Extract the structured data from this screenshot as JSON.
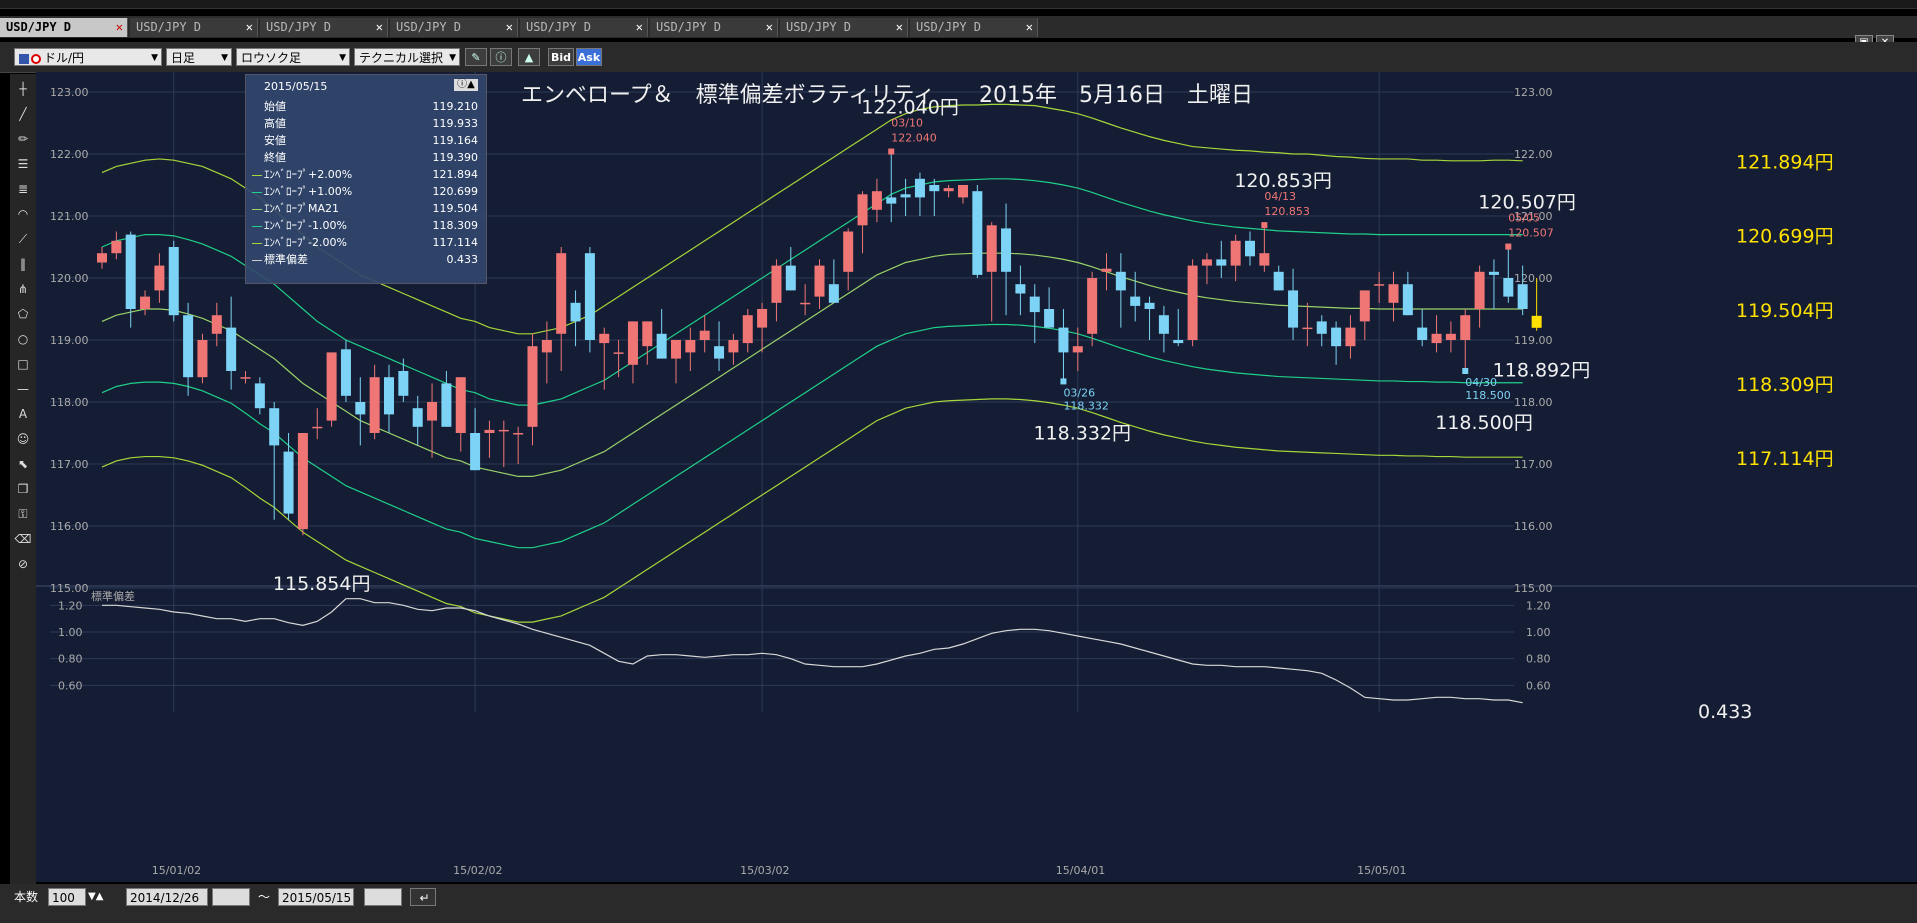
{
  "tabs": [
    {
      "label": "USD/JPY D",
      "active": true
    },
    {
      "label": "USD/JPY D",
      "active": false
    },
    {
      "label": "USD/JPY D",
      "active": false
    },
    {
      "label": "USD/JPY D",
      "active": false
    },
    {
      "label": "USD/JPY D",
      "active": false
    },
    {
      "label": "USD/JPY D",
      "active": false
    },
    {
      "label": "USD/JPY D",
      "active": false
    },
    {
      "label": "USD/JPY D",
      "active": false
    }
  ],
  "toolbar": {
    "currency": "ドル/円",
    "period": "日足",
    "chart_style": "ロウソク足",
    "technical": "テクニカル選択",
    "bid": "Bid",
    "ask": "Ask"
  },
  "info": {
    "date": "2015/05/15",
    "rows": [
      {
        "label": "始値",
        "value": "119.210"
      },
      {
        "label": "高値",
        "value": "119.933"
      },
      {
        "label": "安値",
        "value": "119.164"
      },
      {
        "label": "終値",
        "value": "119.390"
      },
      {
        "label": "ｴﾝﾍﾞﾛｰﾌﾟ+2.00%",
        "value": "121.894",
        "color": "#a6d63a"
      },
      {
        "label": "ｴﾝﾍﾞﾛｰﾌﾟ+1.00%",
        "value": "120.699",
        "color": "#1fd08a"
      },
      {
        "label": "ｴﾝﾍﾞﾛｰﾌﾟMA21",
        "value": "119.504",
        "color": "#9bd36a"
      },
      {
        "label": "ｴﾝﾍﾞﾛｰﾌﾟ-1.00%",
        "value": "118.309",
        "color": "#1fd08a"
      },
      {
        "label": "ｴﾝﾍﾞﾛｰﾌﾟ-2.00%",
        "value": "117.114",
        "color": "#a6d63a"
      },
      {
        "label": "標準偏差",
        "value": "0.433",
        "color": "#cccccc"
      }
    ]
  },
  "bottom": {
    "count_label": "本数",
    "count": "100",
    "from": "2014/12/26",
    "tilde": "～",
    "to": "2015/05/15"
  },
  "chart_data": {
    "type": "candlestick",
    "title": "エンベロープ＆　標準偏差ボラティリティ　　2015年　5月16日　土曜日",
    "ylim": [
      115.0,
      123.0
    ],
    "yticks": [
      "123.00",
      "122.00",
      "121.00",
      "120.00",
      "119.00",
      "118.00",
      "117.00",
      "116.00",
      "115.00"
    ],
    "xticks": [
      "15/01/02",
      "15/02/02",
      "15/03/02",
      "15/04/01",
      "15/05/01"
    ],
    "colors": {
      "up": "#f07676",
      "down": "#7dd3f5",
      "band2": "#a6d63a",
      "band1": "#1fd08a",
      "ma": "#9bd36a"
    },
    "candles": [
      [
        120.25,
        120.5,
        120.15,
        120.4
      ],
      [
        120.4,
        120.75,
        120.3,
        120.6
      ],
      [
        120.7,
        120.75,
        119.2,
        119.5
      ],
      [
        119.5,
        119.8,
        119.4,
        119.7
      ],
      [
        119.8,
        120.4,
        119.6,
        120.2
      ],
      [
        120.5,
        120.6,
        119.3,
        119.4
      ],
      [
        119.4,
        119.6,
        118.1,
        118.4
      ],
      [
        118.4,
        119.1,
        118.3,
        119.0
      ],
      [
        119.1,
        119.6,
        118.9,
        119.4
      ],
      [
        119.2,
        119.7,
        118.2,
        118.5
      ],
      [
        118.4,
        118.5,
        118.3,
        118.4
      ],
      [
        118.3,
        118.4,
        117.8,
        117.9
      ],
      [
        117.9,
        118.0,
        116.1,
        117.3
      ],
      [
        117.2,
        117.5,
        116.1,
        116.2
      ],
      [
        115.95,
        117.5,
        115.85,
        117.5
      ],
      [
        117.6,
        117.9,
        117.4,
        117.6
      ],
      [
        117.7,
        118.8,
        117.6,
        118.8
      ],
      [
        118.85,
        119.0,
        118.0,
        118.1
      ],
      [
        118.0,
        118.4,
        117.3,
        117.8
      ],
      [
        117.5,
        118.6,
        117.4,
        118.4
      ],
      [
        118.4,
        118.6,
        117.5,
        117.8
      ],
      [
        118.5,
        118.7,
        118.0,
        118.1
      ],
      [
        117.9,
        118.1,
        117.3,
        117.6
      ],
      [
        117.7,
        118.3,
        117.1,
        118.0
      ],
      [
        118.3,
        118.5,
        117.6,
        117.6
      ],
      [
        117.5,
        118.2,
        117.2,
        118.4
      ],
      [
        117.5,
        117.9,
        117.0,
        116.9
      ],
      [
        117.5,
        117.7,
        117.1,
        117.55
      ],
      [
        117.55,
        117.7,
        116.95,
        117.55
      ],
      [
        117.5,
        117.6,
        117.0,
        117.5
      ],
      [
        117.6,
        119.1,
        117.3,
        118.9
      ],
      [
        118.8,
        119.3,
        118.3,
        119.0
      ],
      [
        119.1,
        120.5,
        118.5,
        120.4
      ],
      [
        119.6,
        119.8,
        118.9,
        119.3
      ],
      [
        120.4,
        120.5,
        118.8,
        119.0
      ],
      [
        118.95,
        119.2,
        118.2,
        119.1
      ],
      [
        118.8,
        119.0,
        118.4,
        118.8
      ],
      [
        118.6,
        119.3,
        118.3,
        119.3
      ],
      [
        118.9,
        119.3,
        118.6,
        119.3
      ],
      [
        119.1,
        119.5,
        118.8,
        118.7
      ],
      [
        118.7,
        119.0,
        118.3,
        119.0
      ],
      [
        118.8,
        119.2,
        118.5,
        119.0
      ],
      [
        119.0,
        119.4,
        118.8,
        119.15
      ],
      [
        118.9,
        119.3,
        118.5,
        118.7
      ],
      [
        118.8,
        119.1,
        118.6,
        119.0
      ],
      [
        118.95,
        119.5,
        118.8,
        119.4
      ],
      [
        119.2,
        119.6,
        118.8,
        119.5
      ],
      [
        119.6,
        120.3,
        119.3,
        120.2
      ],
      [
        120.2,
        120.5,
        119.8,
        119.8
      ],
      [
        119.6,
        119.9,
        119.4,
        119.6
      ],
      [
        119.7,
        120.3,
        119.5,
        120.2
      ],
      [
        119.9,
        120.3,
        119.6,
        119.6
      ],
      [
        120.1,
        120.8,
        119.8,
        120.75
      ],
      [
        120.85,
        121.4,
        120.4,
        121.35
      ],
      [
        121.1,
        121.6,
        120.9,
        121.4
      ],
      [
        121.3,
        122.04,
        120.9,
        121.2
      ],
      [
        121.35,
        121.6,
        121.0,
        121.3
      ],
      [
        121.6,
        121.7,
        121.0,
        121.3
      ],
      [
        121.5,
        121.6,
        121.0,
        121.4
      ],
      [
        121.4,
        121.5,
        121.3,
        121.45
      ],
      [
        121.3,
        121.5,
        121.2,
        121.5
      ],
      [
        121.4,
        121.5,
        120.0,
        120.05
      ],
      [
        120.1,
        120.9,
        119.3,
        120.85
      ],
      [
        120.8,
        121.2,
        119.4,
        120.1
      ],
      [
        119.9,
        120.2,
        119.4,
        119.75
      ],
      [
        119.7,
        119.9,
        118.95,
        119.45
      ],
      [
        119.5,
        119.85,
        119.2,
        119.2
      ],
      [
        119.2,
        119.5,
        118.33,
        118.8
      ],
      [
        118.8,
        119.2,
        118.5,
        118.9
      ],
      [
        119.1,
        120.1,
        118.9,
        120.0
      ],
      [
        120.1,
        120.4,
        119.8,
        120.15
      ],
      [
        120.1,
        120.4,
        119.2,
        119.8
      ],
      [
        119.7,
        120.1,
        119.3,
        119.55
      ],
      [
        119.6,
        119.7,
        119.0,
        119.5
      ],
      [
        119.4,
        119.55,
        118.8,
        119.1
      ],
      [
        119.0,
        119.5,
        118.9,
        118.95
      ],
      [
        119.0,
        120.3,
        118.9,
        120.2
      ],
      [
        120.2,
        120.4,
        119.9,
        120.3
      ],
      [
        120.3,
        120.6,
        120.0,
        120.2
      ],
      [
        120.2,
        120.7,
        119.95,
        120.6
      ],
      [
        120.6,
        120.75,
        120.2,
        120.35
      ],
      [
        120.2,
        120.85,
        120.1,
        120.4
      ],
      [
        120.1,
        120.2,
        119.8,
        119.8
      ],
      [
        119.8,
        120.15,
        119.0,
        119.2
      ],
      [
        119.2,
        119.6,
        118.9,
        119.2
      ],
      [
        119.3,
        119.4,
        118.9,
        119.1
      ],
      [
        119.2,
        119.3,
        118.6,
        118.9
      ],
      [
        118.9,
        119.4,
        118.7,
        119.2
      ],
      [
        119.3,
        119.8,
        119.0,
        119.8
      ],
      [
        119.9,
        120.1,
        119.6,
        119.9
      ],
      [
        119.6,
        120.1,
        119.3,
        119.9
      ],
      [
        119.9,
        120.1,
        119.4,
        119.4
      ],
      [
        119.2,
        119.5,
        118.9,
        119.0
      ],
      [
        118.95,
        119.4,
        118.8,
        119.1
      ],
      [
        119.0,
        119.3,
        118.8,
        119.1
      ],
      [
        119.0,
        119.5,
        118.5,
        119.4
      ],
      [
        119.5,
        120.2,
        119.2,
        120.1
      ],
      [
        120.1,
        120.3,
        119.5,
        120.05
      ],
      [
        120.0,
        120.51,
        119.6,
        119.7
      ],
      [
        119.9,
        120.2,
        119.4,
        119.5
      ]
    ],
    "env_plus2": [
      121.7,
      121.8,
      121.85,
      121.9,
      121.92,
      121.9,
      121.85,
      121.8,
      121.7,
      121.6,
      121.45,
      121.3,
      121.1,
      120.9,
      120.7,
      120.5,
      120.35,
      120.2,
      120.05,
      119.95,
      119.85,
      119.75,
      119.65,
      119.55,
      119.45,
      119.35,
      119.3,
      119.2,
      119.15,
      119.1,
      119.1,
      119.15,
      119.2,
      119.3,
      119.4,
      119.55,
      119.7,
      119.85,
      120.0,
      120.15,
      120.3,
      120.45,
      120.6,
      120.75,
      120.9,
      121.05,
      121.2,
      121.35,
      121.5,
      121.65,
      121.8,
      121.95,
      122.1,
      122.25,
      122.4,
      122.55,
      122.65,
      122.72,
      122.76,
      122.78,
      122.79,
      122.79,
      122.8,
      122.8,
      122.79,
      122.78,
      122.74,
      122.7,
      122.65,
      122.58,
      122.5,
      122.42,
      122.35,
      122.28,
      122.22,
      122.17,
      122.12,
      122.1,
      122.08,
      122.06,
      122.05,
      122.03,
      122.02,
      122.0,
      122.0,
      121.98,
      121.96,
      121.95,
      121.93,
      121.92,
      121.92,
      121.92,
      121.9,
      121.9,
      121.89,
      121.89,
      121.89,
      121.9,
      121.9,
      121.89
    ],
    "env_plus1": [
      120.5,
      120.6,
      120.65,
      120.7,
      120.7,
      120.68,
      120.62,
      120.55,
      120.45,
      120.35,
      120.2,
      120.05,
      119.9,
      119.7,
      119.5,
      119.3,
      119.15,
      119.0,
      118.9,
      118.8,
      118.7,
      118.6,
      118.5,
      118.4,
      118.3,
      118.2,
      118.15,
      118.05,
      118.0,
      117.95,
      117.95,
      118.0,
      118.05,
      118.15,
      118.25,
      118.35,
      118.5,
      118.65,
      118.8,
      118.95,
      119.1,
      119.25,
      119.4,
      119.55,
      119.7,
      119.85,
      120.0,
      120.15,
      120.3,
      120.45,
      120.6,
      120.75,
      120.9,
      121.05,
      121.2,
      121.35,
      121.45,
      121.5,
      121.55,
      121.57,
      121.58,
      121.59,
      121.6,
      121.6,
      121.59,
      121.57,
      121.54,
      121.5,
      121.45,
      121.38,
      121.3,
      121.22,
      121.15,
      121.08,
      121.02,
      120.97,
      120.92,
      120.88,
      120.85,
      120.82,
      120.8,
      120.78,
      120.76,
      120.75,
      120.74,
      120.73,
      120.72,
      120.71,
      120.71,
      120.7,
      120.7,
      120.7,
      120.7,
      120.7,
      120.7,
      120.7,
      120.7,
      120.7,
      120.7,
      120.7
    ],
    "ma21": [
      119.3,
      119.4,
      119.45,
      119.5,
      119.5,
      119.48,
      119.42,
      119.35,
      119.25,
      119.15,
      119.0,
      118.85,
      118.7,
      118.5,
      118.3,
      118.15,
      118.0,
      117.85,
      117.7,
      117.6,
      117.5,
      117.4,
      117.3,
      117.2,
      117.1,
      117.05,
      116.95,
      116.9,
      116.85,
      116.8,
      116.8,
      116.85,
      116.9,
      117.0,
      117.1,
      117.2,
      117.35,
      117.5,
      117.65,
      117.8,
      117.95,
      118.1,
      118.25,
      118.4,
      118.55,
      118.7,
      118.85,
      119.0,
      119.15,
      119.3,
      119.45,
      119.6,
      119.75,
      119.9,
      120.05,
      120.15,
      120.25,
      120.3,
      120.35,
      120.38,
      120.39,
      120.4,
      120.4,
      120.4,
      120.39,
      120.37,
      120.34,
      120.3,
      120.25,
      120.18,
      120.1,
      120.02,
      119.95,
      119.88,
      119.82,
      119.77,
      119.72,
      119.68,
      119.65,
      119.62,
      119.6,
      119.58,
      119.56,
      119.55,
      119.54,
      119.53,
      119.52,
      119.51,
      119.51,
      119.5,
      119.5,
      119.5,
      119.5,
      119.5,
      119.5,
      119.5,
      119.5,
      119.5,
      119.5,
      119.5
    ],
    "env_minus1": [
      118.15,
      118.25,
      118.3,
      118.32,
      118.32,
      118.3,
      118.25,
      118.18,
      118.08,
      117.98,
      117.82,
      117.65,
      117.5,
      117.3,
      117.1,
      116.95,
      116.8,
      116.65,
      116.55,
      116.45,
      116.35,
      116.25,
      116.15,
      116.05,
      115.95,
      115.9,
      115.8,
      115.75,
      115.7,
      115.65,
      115.65,
      115.7,
      115.75,
      115.85,
      115.95,
      116.05,
      116.2,
      116.35,
      116.5,
      116.65,
      116.8,
      116.95,
      117.1,
      117.25,
      117.4,
      117.55,
      117.7,
      117.85,
      118.0,
      118.15,
      118.3,
      118.45,
      118.6,
      118.75,
      118.9,
      119.0,
      119.1,
      119.15,
      119.2,
      119.22,
      119.23,
      119.24,
      119.25,
      119.25,
      119.24,
      119.22,
      119.19,
      119.15,
      119.1,
      119.03,
      118.95,
      118.87,
      118.8,
      118.73,
      118.67,
      118.62,
      118.57,
      118.53,
      118.5,
      118.47,
      118.45,
      118.43,
      118.41,
      118.4,
      118.39,
      118.38,
      118.37,
      118.36,
      118.35,
      118.34,
      118.34,
      118.33,
      118.33,
      118.32,
      118.32,
      118.31,
      118.31,
      118.31,
      118.31,
      118.31
    ],
    "env_minus2": [
      116.95,
      117.05,
      117.1,
      117.12,
      117.12,
      117.1,
      117.05,
      116.98,
      116.88,
      116.78,
      116.62,
      116.45,
      116.3,
      116.1,
      115.9,
      115.75,
      115.6,
      115.45,
      115.35,
      115.25,
      115.15,
      115.05,
      114.95,
      114.85,
      114.75,
      114.7,
      114.6,
      114.55,
      114.5,
      114.45,
      114.45,
      114.5,
      114.55,
      114.65,
      114.75,
      114.85,
      115.0,
      115.15,
      115.3,
      115.45,
      115.6,
      115.75,
      115.9,
      116.05,
      116.2,
      116.35,
      116.5,
      116.65,
      116.8,
      116.95,
      117.1,
      117.25,
      117.4,
      117.55,
      117.7,
      117.8,
      117.9,
      117.95,
      118.0,
      118.02,
      118.03,
      118.04,
      118.05,
      118.05,
      118.04,
      118.02,
      117.99,
      117.95,
      117.9,
      117.83,
      117.75,
      117.67,
      117.6,
      117.53,
      117.47,
      117.42,
      117.37,
      117.33,
      117.3,
      117.27,
      117.25,
      117.23,
      117.21,
      117.2,
      117.19,
      117.18,
      117.17,
      117.16,
      117.15,
      117.14,
      117.14,
      117.13,
      117.13,
      117.12,
      117.12,
      117.11,
      117.11,
      117.11,
      117.11,
      117.11
    ],
    "stdev": [
      1.2,
      1.2,
      1.19,
      1.18,
      1.17,
      1.15,
      1.14,
      1.12,
      1.1,
      1.1,
      1.08,
      1.1,
      1.1,
      1.07,
      1.05,
      1.08,
      1.15,
      1.25,
      1.25,
      1.22,
      1.22,
      1.2,
      1.17,
      1.16,
      1.18,
      1.18,
      1.16,
      1.12,
      1.09,
      1.06,
      1.02,
      0.99,
      0.96,
      0.93,
      0.9,
      0.84,
      0.78,
      0.76,
      0.82,
      0.83,
      0.83,
      0.82,
      0.81,
      0.82,
      0.83,
      0.83,
      0.84,
      0.83,
      0.8,
      0.76,
      0.75,
      0.74,
      0.74,
      0.74,
      0.76,
      0.79,
      0.82,
      0.84,
      0.87,
      0.88,
      0.91,
      0.95,
      0.99,
      1.01,
      1.02,
      1.02,
      1.01,
      0.99,
      0.97,
      0.95,
      0.93,
      0.91,
      0.88,
      0.85,
      0.82,
      0.79,
      0.76,
      0.75,
      0.75,
      0.74,
      0.74,
      0.74,
      0.73,
      0.72,
      0.71,
      0.69,
      0.64,
      0.58,
      0.51,
      0.5,
      0.49,
      0.49,
      0.5,
      0.51,
      0.51,
      0.5,
      0.5,
      0.49,
      0.49,
      0.47
    ],
    "stdev_ylim": [
      0.4,
      1.3
    ],
    "stdev_yticks": [
      "1.20",
      "1.00",
      "0.80",
      "0.60"
    ],
    "stdev_label": "標準偏差",
    "right_labels": [
      {
        "text": "121.894円",
        "value": 121.894
      },
      {
        "text": "120.699円",
        "value": 120.699
      },
      {
        "text": "119.504円",
        "value": 119.504
      },
      {
        "text": "118.309円",
        "value": 118.309
      },
      {
        "text": "117.114円",
        "value": 117.114
      }
    ],
    "annotations": [
      {
        "text": "115.854円",
        "index": 14,
        "value": 115.854
      },
      {
        "text": "122.040円",
        "index": 55,
        "value": 122.04,
        "date": "03/10",
        "price": "122.040",
        "high": true
      },
      {
        "text": "118.332円",
        "index": 67,
        "value": 118.332,
        "date": "03/26",
        "price": "118.332",
        "high": false
      },
      {
        "text": "120.853円",
        "index": 81,
        "value": 120.853,
        "date": "04/13",
        "price": "120.853",
        "high": true
      },
      {
        "text": "118.500円",
        "index": 95,
        "value": 118.5,
        "date": "04/30",
        "price": "118.500",
        "high": false
      },
      {
        "text": "120.507円",
        "index": 98,
        "value": 120.507,
        "date": "05/05",
        "price": "120.507",
        "high": true
      },
      {
        "text": "118.892円",
        "index": 99,
        "value": 118.892
      }
    ],
    "stdev_value_label": "0.433"
  }
}
